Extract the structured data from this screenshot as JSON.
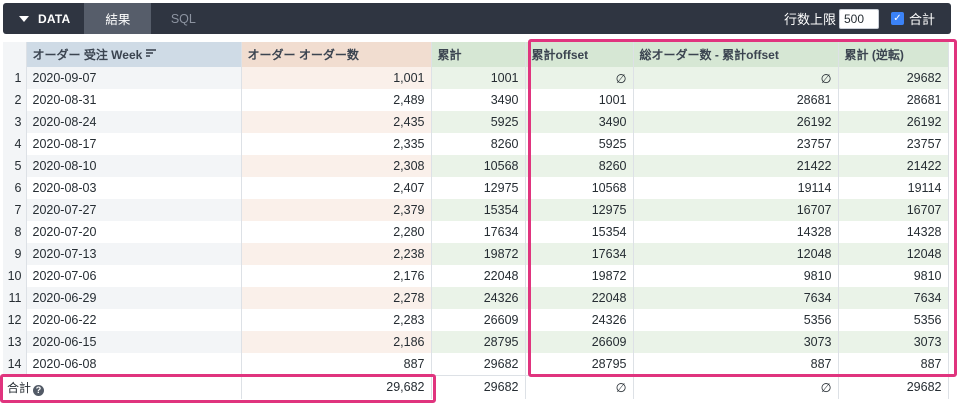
{
  "toolbar": {
    "data_label": "DATA",
    "tabs": [
      {
        "label": "結果",
        "active": true
      },
      {
        "label": "SQL",
        "active": false
      }
    ],
    "row_limit_label": "行数上限",
    "row_limit_value": "500",
    "totals_label": "合計",
    "totals_checked": true
  },
  "table": {
    "headers": {
      "week": "オーダー 受注 Week",
      "count": "オーダー オーダー数",
      "cumsum": "累計",
      "offset": "累計offset",
      "diff": "総オーダー数 - 累計offset",
      "reverse": "累計 (逆転)"
    },
    "null_symbol": "∅",
    "rows": [
      {
        "n": "1",
        "week": "2020-09-07",
        "count": "1,001",
        "cumsum": "1001",
        "offset": null,
        "diff": null,
        "reverse": "29682"
      },
      {
        "n": "2",
        "week": "2020-08-31",
        "count": "2,489",
        "cumsum": "3490",
        "offset": "1001",
        "diff": "28681",
        "reverse": "28681"
      },
      {
        "n": "3",
        "week": "2020-08-24",
        "count": "2,435",
        "cumsum": "5925",
        "offset": "3490",
        "diff": "26192",
        "reverse": "26192"
      },
      {
        "n": "4",
        "week": "2020-08-17",
        "count": "2,335",
        "cumsum": "8260",
        "offset": "5925",
        "diff": "23757",
        "reverse": "23757"
      },
      {
        "n": "5",
        "week": "2020-08-10",
        "count": "2,308",
        "cumsum": "10568",
        "offset": "8260",
        "diff": "21422",
        "reverse": "21422"
      },
      {
        "n": "6",
        "week": "2020-08-03",
        "count": "2,407",
        "cumsum": "12975",
        "offset": "10568",
        "diff": "19114",
        "reverse": "19114"
      },
      {
        "n": "7",
        "week": "2020-07-27",
        "count": "2,379",
        "cumsum": "15354",
        "offset": "12975",
        "diff": "16707",
        "reverse": "16707"
      },
      {
        "n": "8",
        "week": "2020-07-20",
        "count": "2,280",
        "cumsum": "17634",
        "offset": "15354",
        "diff": "14328",
        "reverse": "14328"
      },
      {
        "n": "9",
        "week": "2020-07-13",
        "count": "2,238",
        "cumsum": "19872",
        "offset": "17634",
        "diff": "12048",
        "reverse": "12048"
      },
      {
        "n": "10",
        "week": "2020-07-06",
        "count": "2,176",
        "cumsum": "22048",
        "offset": "19872",
        "diff": "9810",
        "reverse": "9810"
      },
      {
        "n": "11",
        "week": "2020-06-29",
        "count": "2,278",
        "cumsum": "24326",
        "offset": "22048",
        "diff": "7634",
        "reverse": "7634"
      },
      {
        "n": "12",
        "week": "2020-06-22",
        "count": "2,283",
        "cumsum": "26609",
        "offset": "24326",
        "diff": "5356",
        "reverse": "5356"
      },
      {
        "n": "13",
        "week": "2020-06-15",
        "count": "2,186",
        "cumsum": "28795",
        "offset": "26609",
        "diff": "3073",
        "reverse": "3073"
      },
      {
        "n": "14",
        "week": "2020-06-08",
        "count": "887",
        "cumsum": "29682",
        "offset": "28795",
        "diff": "887",
        "reverse": "887"
      }
    ],
    "totals": {
      "label": "合計",
      "count": "29,682",
      "cumsum": "29682",
      "offset": null,
      "diff": null,
      "reverse": "29682"
    }
  },
  "colors": {
    "highlight": "#e0347e",
    "toolbar_bg": "#2f3541"
  }
}
